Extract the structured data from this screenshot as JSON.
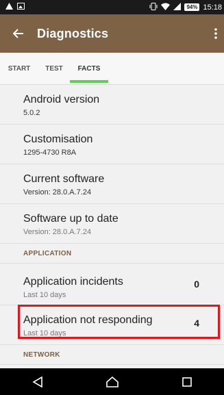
{
  "statusbar": {
    "time": "15:18",
    "battery": "94%"
  },
  "appbar": {
    "title": "Diagnostics"
  },
  "tabs": [
    {
      "label": "START"
    },
    {
      "label": "TEST"
    },
    {
      "label": "FACTS"
    }
  ],
  "facts": [
    {
      "label": "Android version",
      "sub": "5.0.2"
    },
    {
      "label": "Customisation",
      "sub": "1295-4730 R8A"
    },
    {
      "label": "Current software",
      "sub": "Version: 28.0.A.7.24"
    },
    {
      "label": "Software up to date",
      "sub": "Version: 28.0.A.7.24"
    }
  ],
  "sections": {
    "application": "APPLICATION",
    "network": "NETWORK"
  },
  "application": [
    {
      "label": "Application incidents",
      "sub": "Last 10 days",
      "value": "0"
    },
    {
      "label": "Application not responding",
      "sub": "Last 10 days",
      "value": "4"
    }
  ],
  "colors": {
    "appbar": "#7e6246",
    "tab_indicator": "#5fcf56",
    "highlight": "#e8141b"
  }
}
